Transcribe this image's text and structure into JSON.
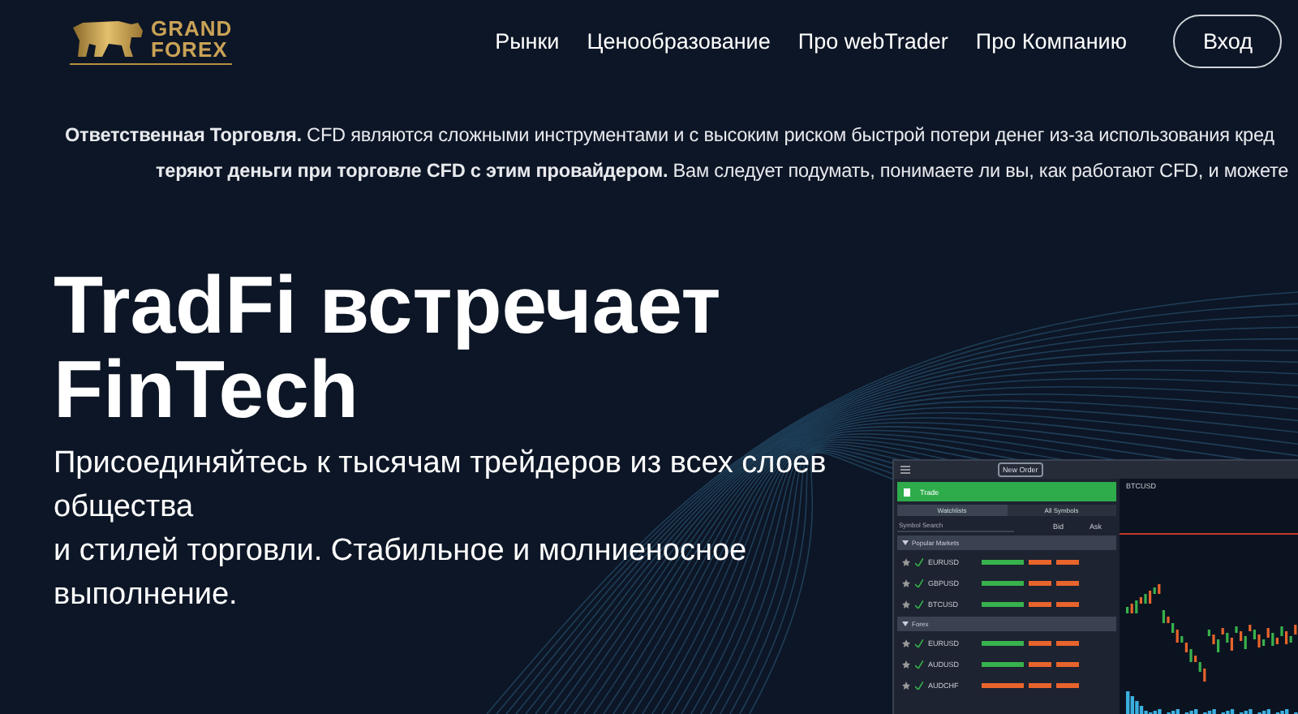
{
  "header": {
    "logo": {
      "line_1": "GRAND",
      "line_2": "FOREX"
    },
    "nav": [
      "Рынки",
      "Ценообразование",
      "Про webTrader",
      "Про Компанию"
    ],
    "login": "Вход"
  },
  "risk_warning": {
    "lines": [
      "**Ответственная Торговля.** CFD являются сложными инструментами и с высоким риском быстрой потери денег из-за использования кред",
      "**теряют деньги при торговле CFD с этим провайдером.** Вам следует подумать, понимаете ли вы, как работают CFD, и можете"
    ]
  },
  "hero": {
    "title": [
      "TradFi встречает",
      "FinTech"
    ],
    "subtitle": [
      "Присоединяйтесь к тысячам трейдеров из всех слоев общества",
      "и стилей торговли. Стабильное и молниеносное выполнение."
    ]
  },
  "app_preview": {
    "new_order": "New Order",
    "trade": "Trade",
    "tabs": [
      {
        "label": "Watchlists",
        "selected": true
      },
      {
        "label": "All Symbols",
        "selected": false
      }
    ],
    "search": {
      "placeholder": "Symbol Search"
    },
    "bid": "Bid",
    "ask": "Ask",
    "chart_symbol": "BTCUSD",
    "sections": [
      {
        "title": "Popular Markets",
        "rows": [
          {
            "symbol": "EURUSD",
            "color": "#37b24d"
          },
          {
            "symbol": "GBPUSD",
            "color": "#37b24d"
          },
          {
            "symbol": "BTCUSD",
            "color": "#37b24d"
          }
        ]
      },
      {
        "title": "Forex",
        "rows": [
          {
            "symbol": "EURUSD",
            "color": "#37b24d"
          },
          {
            "symbol": "AUDUSD",
            "color": "#37b24d"
          },
          {
            "symbol": "AUDCHF",
            "color": "#e8642c"
          }
        ]
      }
    ]
  }
}
